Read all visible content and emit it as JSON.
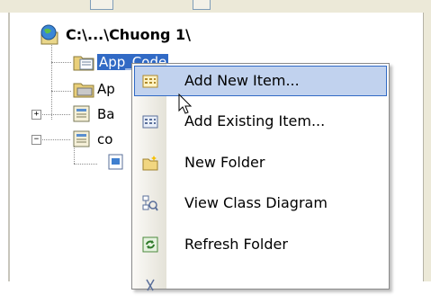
{
  "tree": {
    "root_label": "C:\\...\\Chuong 1\\",
    "nodes": [
      {
        "label": "App_Code",
        "selected": true,
        "icon": "folder-icon"
      },
      {
        "label": "Ap",
        "icon": "folder-icon"
      },
      {
        "label": "Ba",
        "icon": "file-icon"
      },
      {
        "label": "co",
        "icon": "file-icon"
      }
    ]
  },
  "context_menu": {
    "items": [
      {
        "label": "Add New Item...",
        "icon": "add-new-item-icon",
        "highlighted": true
      },
      {
        "label": "Add Existing Item...",
        "icon": "add-existing-item-icon"
      },
      {
        "label": "New Folder",
        "icon": "new-folder-icon"
      },
      {
        "label": "View Class Diagram",
        "icon": "class-diagram-icon"
      },
      {
        "label": "Refresh Folder",
        "icon": "refresh-icon"
      }
    ]
  },
  "colors": {
    "selection": "#316ac5",
    "menu_highlight": "#c1d2ee",
    "chrome": "#ece9d8"
  }
}
